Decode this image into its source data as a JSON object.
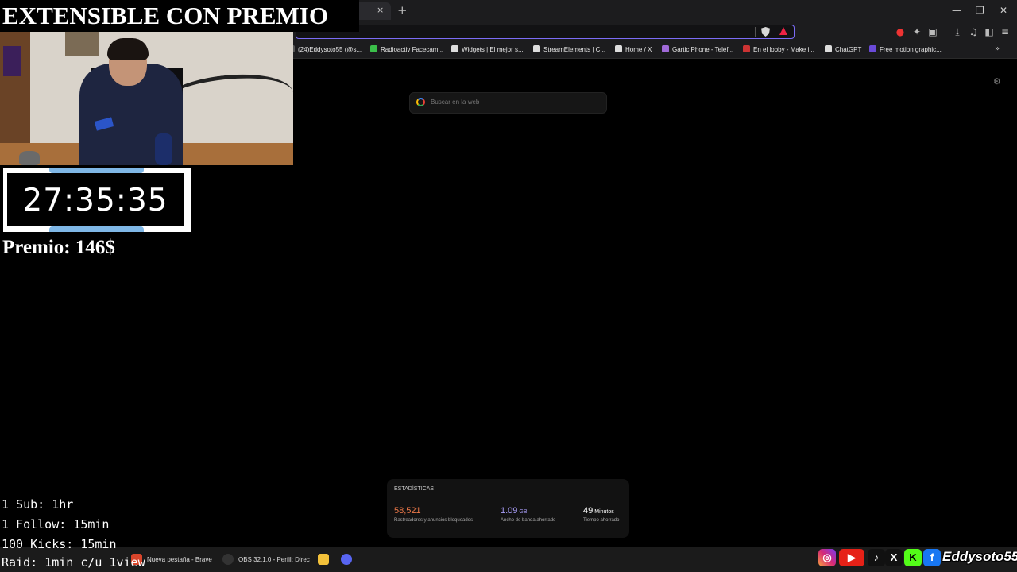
{
  "overlay": {
    "title": "EXTENSIBLE CON PREMIO",
    "timer": "27:35:35",
    "prize": "Premio: 146$",
    "rules": [
      "1 Sub: 1hr",
      "1 Follow: 15min",
      "100 Kicks: 15min",
      "Raid: 1min c/u 1view"
    ],
    "social_handle": "Eddysoto55",
    "social_icons": [
      "instagram-icon",
      "youtube-icon",
      "tiktok-icon",
      "x-icon",
      "kick-icon",
      "facebook-icon"
    ]
  },
  "browser": {
    "tab_close": "×",
    "new_tab": "+",
    "window_controls": [
      "—",
      "❐",
      "✕"
    ],
    "bookmarks": [
      {
        "label": "(24)Eddysoto55 (@s...",
        "color": "#555"
      },
      {
        "label": "Radioactiv Facecam...",
        "color": "#3bbf4a"
      },
      {
        "label": "Widgets | El mejor s...",
        "color": "#ddd"
      },
      {
        "label": "StreamElements | C...",
        "color": "#ddd"
      },
      {
        "label": "Home / X",
        "color": "#ddd"
      },
      {
        "label": "Gartic Phone - Teléf...",
        "color": "#a06ad8"
      },
      {
        "label": "En el lobby - Make i...",
        "color": "#c33"
      },
      {
        "label": "ChatGPT",
        "color": "#ddd"
      },
      {
        "label": "Free motion graphic...",
        "color": "#6a4ad8"
      }
    ],
    "bookmarks_more": "»"
  },
  "newtab": {
    "search_placeholder": "Buscar en la web",
    "stats_title": "ESTADÍSTICAS",
    "stats": [
      {
        "value": "58,521",
        "unit": "",
        "label": "Rastreadores y anuncios bloqueados",
        "color": "#f07a4a"
      },
      {
        "value": "1.09",
        "unit": "GB",
        "label": "Ancho de banda ahorrado",
        "color": "#a79cf5"
      },
      {
        "value": "49",
        "unit": "Minutos",
        "label": "Tiempo ahorrado",
        "color": "#ffffff"
      }
    ]
  },
  "taskbar": {
    "items": [
      "Nueva pestaña - Brave",
      "OBS 32.1.0 - Perfil: Direc"
    ]
  }
}
